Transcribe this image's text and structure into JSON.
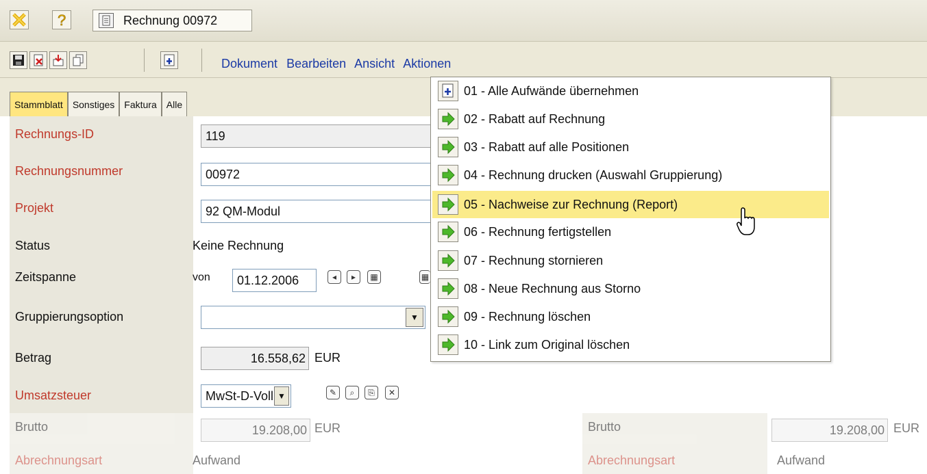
{
  "window": {
    "doc_title": "Rechnung 00972"
  },
  "menu": {
    "dokument": "Dokument",
    "bearbeiten": "Bearbeiten",
    "ansicht": "Ansicht",
    "aktionen": "Aktionen"
  },
  "tabs": [
    "Stammblatt",
    "Sonstiges",
    "Faktura",
    "Alle"
  ],
  "form": {
    "rechnungs_id": {
      "label": "Rechnungs-ID",
      "value": "119"
    },
    "rechnungsnummer": {
      "label": "Rechnungsnummer",
      "value": "00972"
    },
    "projekt": {
      "label": "Projekt",
      "value": "92 QM-Modul"
    },
    "status": {
      "label": "Status",
      "value": "Keine Rechnung"
    },
    "zeitspanne": {
      "label": "Zeitspanne",
      "von_label": "von",
      "von_value": "01.12.2006"
    },
    "gruppierung": {
      "label": "Gruppierungsoption",
      "value": ""
    },
    "betrag": {
      "label": "Betrag",
      "value": "16.558,62",
      "currency": "EUR"
    },
    "umsatzsteuer": {
      "label": "Umsatzsteuer",
      "value": "MwSt-D-Voll"
    },
    "brutto": {
      "label": "Brutto",
      "value": "19.208,00",
      "currency": "EUR"
    },
    "abrechnungsart": {
      "label": "Abrechnungsart",
      "value": "Aufwand"
    },
    "abrechnungsart_right": {
      "label": "Abrechnungsart",
      "value": "Aufwand"
    },
    "brutto_right": {
      "label": "Brutto",
      "value": "19.208,00",
      "currency": "EUR"
    }
  },
  "actions_menu": [
    {
      "label": "01 - Alle Aufwände übernehmen",
      "icon": "add-doc-icon"
    },
    {
      "label": "02 - Rabatt auf Rechnung",
      "icon": "green-arrow-icon"
    },
    {
      "label": "03 - Rabatt auf alle Positionen",
      "icon": "green-arrow-icon"
    },
    {
      "label": "04 - Rechnung drucken (Auswahl Gruppierung)",
      "icon": "green-arrow-icon"
    },
    {
      "label": "05 - Nachweise zur Rechnung (Report)",
      "icon": "green-arrow-icon"
    },
    {
      "label": "06 - Rechnung fertigstellen",
      "icon": "green-arrow-icon"
    },
    {
      "label": "07 - Rechnung stornieren",
      "icon": "green-arrow-icon"
    },
    {
      "label": "08 - Neue Rechnung aus Storno",
      "icon": "green-arrow-icon"
    },
    {
      "label": "09 - Rechnung löschen",
      "icon": "green-arrow-icon"
    },
    {
      "label": "10 - Link zum Original löschen",
      "icon": "green-arrow-icon"
    }
  ],
  "colors": {
    "highlight": "#fbeb8a",
    "active_tab": "#ffe680",
    "menu_text": "#1b3aa5",
    "required_label": "#c0392b",
    "arrow_green": "#4db82b"
  }
}
